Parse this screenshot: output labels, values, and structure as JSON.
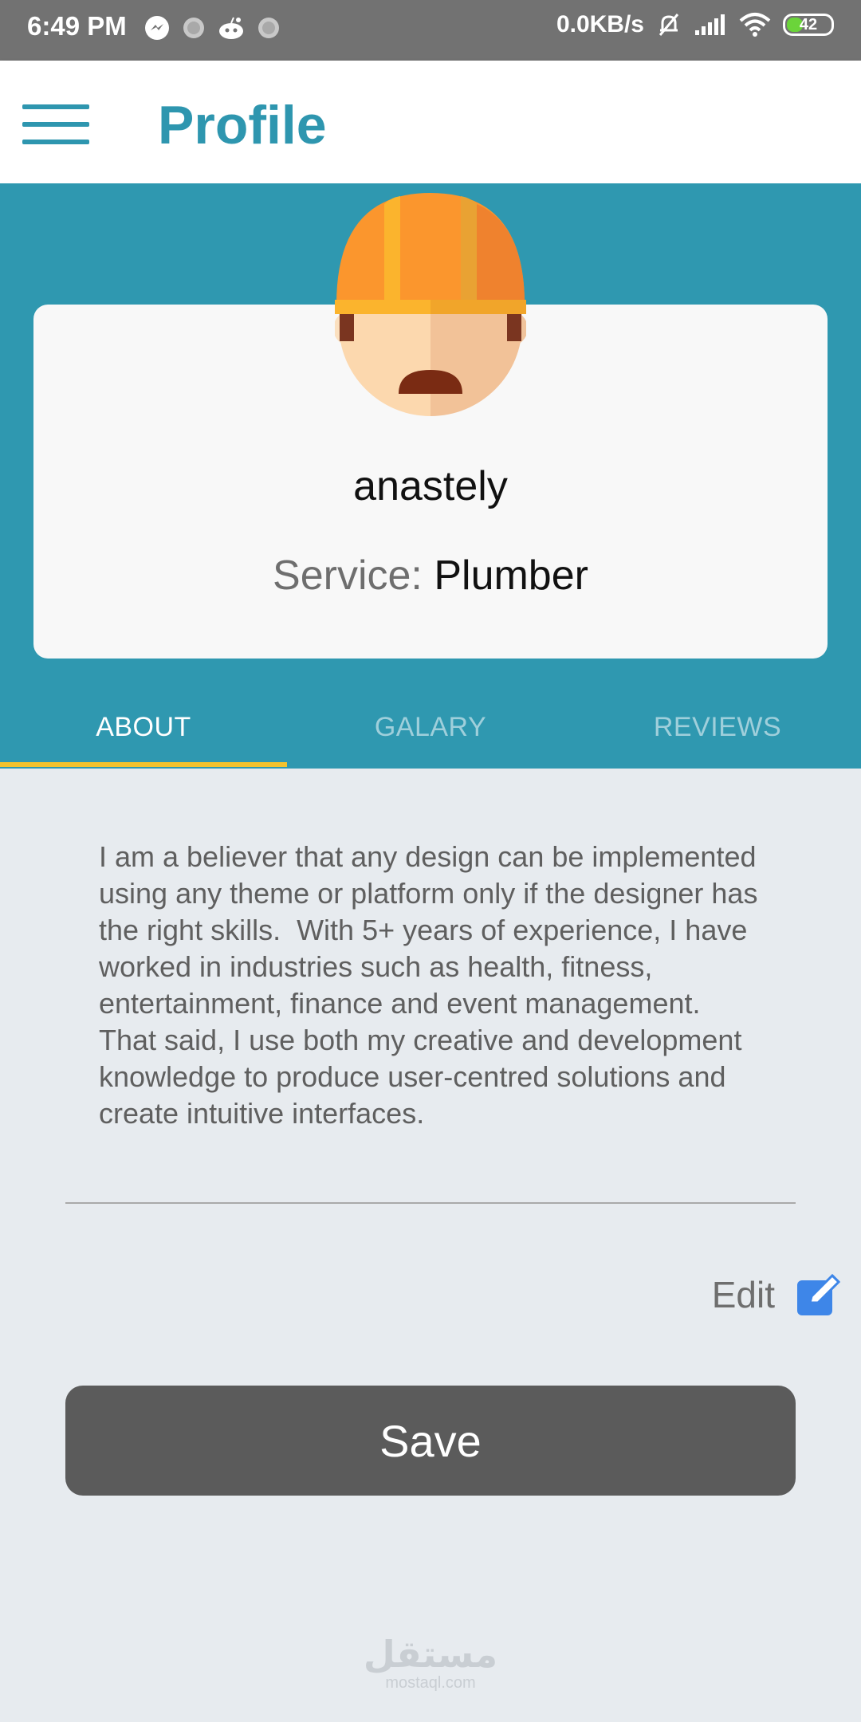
{
  "status_bar": {
    "time": "6:49 PM",
    "left_icons": [
      "messenger-icon",
      "notification-dot-icon",
      "reddit-icon",
      "notification-dot-icon"
    ],
    "net_speed": "0.0KB/s",
    "right_icons": [
      "bell-off-icon",
      "signal-icon",
      "wifi-icon"
    ],
    "battery_level": "42",
    "battery_fraction": 0.42,
    "battery_color": "#6BD43A"
  },
  "app_bar": {
    "title": "Profile",
    "menu_icon": "hamburger-menu-icon",
    "accent_color": "#2E96AF"
  },
  "profile": {
    "avatar_icon": "worker-hardhat-avatar-icon",
    "username": "anastely",
    "service_label": "Service: ",
    "service_value": "Plumber"
  },
  "tabs": [
    {
      "label": "ABOUT",
      "active": true
    },
    {
      "label": "GALARY",
      "active": false
    },
    {
      "label": "REVIEWS",
      "active": false
    }
  ],
  "about": {
    "text": "I am a believer that any design can be implemented using any theme or platform only if the designer has the right skills.  With 5+ years of experience, I have worked in industries such as health, fitness, entertainment, finance and event management.   That said, I use both my creative and development knowledge to produce user-centred solutions and create intuitive interfaces."
  },
  "edit": {
    "label": "Edit",
    "icon": "edit-icon"
  },
  "save_button": {
    "label": "Save"
  },
  "watermark": {
    "arabic": "مستقل",
    "latin": "mostaql.com"
  },
  "colors": {
    "header_band": "#2F98B0",
    "tab_indicator": "#F2C22E",
    "page_background": "#E7EBEF",
    "save_button": "#5B5B5B"
  }
}
